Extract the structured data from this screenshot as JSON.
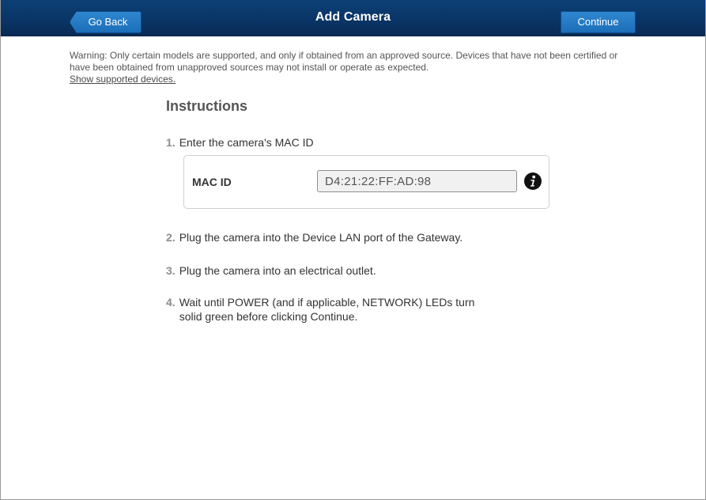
{
  "header": {
    "title": "Add Camera",
    "back_label": "Go Back",
    "continue_label": "Continue"
  },
  "warning": {
    "text": "Warning: Only certain models are supported, and only if obtained from an approved source. Devices that have not been certified or have been obtained from unapproved sources may not install or operate as expected.",
    "link_label": "Show supported devices."
  },
  "instructions": {
    "title": "Instructions",
    "steps": [
      {
        "number": "1.",
        "text": "Enter the camera's MAC ID"
      },
      {
        "number": "2.",
        "text": "Plug the camera into the Device LAN port of the Gateway."
      },
      {
        "number": "3.",
        "text": "Plug the camera into an electrical outlet."
      },
      {
        "number": "4.",
        "text_line1": "Wait until POWER (and if applicable, NETWORK) LEDs turn",
        "text_line2": "solid green before clicking Continue."
      }
    ]
  },
  "mac_field": {
    "label": "MAC ID",
    "value": "D4:21:22:FF:AD:98",
    "info_icon": "info-icon"
  },
  "colors": {
    "header_bg": "#0a3566",
    "button_bg": "#1f74be",
    "warning_text": "#555555"
  }
}
